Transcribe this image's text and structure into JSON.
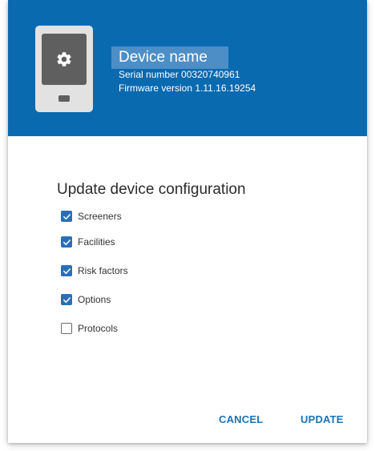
{
  "device": {
    "name": "Device name",
    "serial_label": "Serial number 00320740961",
    "firmware_label": "Firmware version 1.11.16.19254"
  },
  "dialog": {
    "title": "Update device configuration",
    "options": [
      {
        "label": "Screeners",
        "checked": true
      },
      {
        "label": "Facilities",
        "checked": true
      },
      {
        "label": "Risk factors",
        "checked": true
      },
      {
        "label": "Options",
        "checked": true
      },
      {
        "label": "Protocols",
        "checked": false
      }
    ],
    "cancel_label": "CANCEL",
    "update_label": "UPDATE"
  },
  "colors": {
    "header_bg": "#0A6AB0",
    "accent": "#1a73b5",
    "checkbox_checked": "#2a6fb6"
  },
  "icons": {
    "device": "tablet-icon",
    "settings": "gear-icon",
    "checkbox": "check-icon"
  }
}
